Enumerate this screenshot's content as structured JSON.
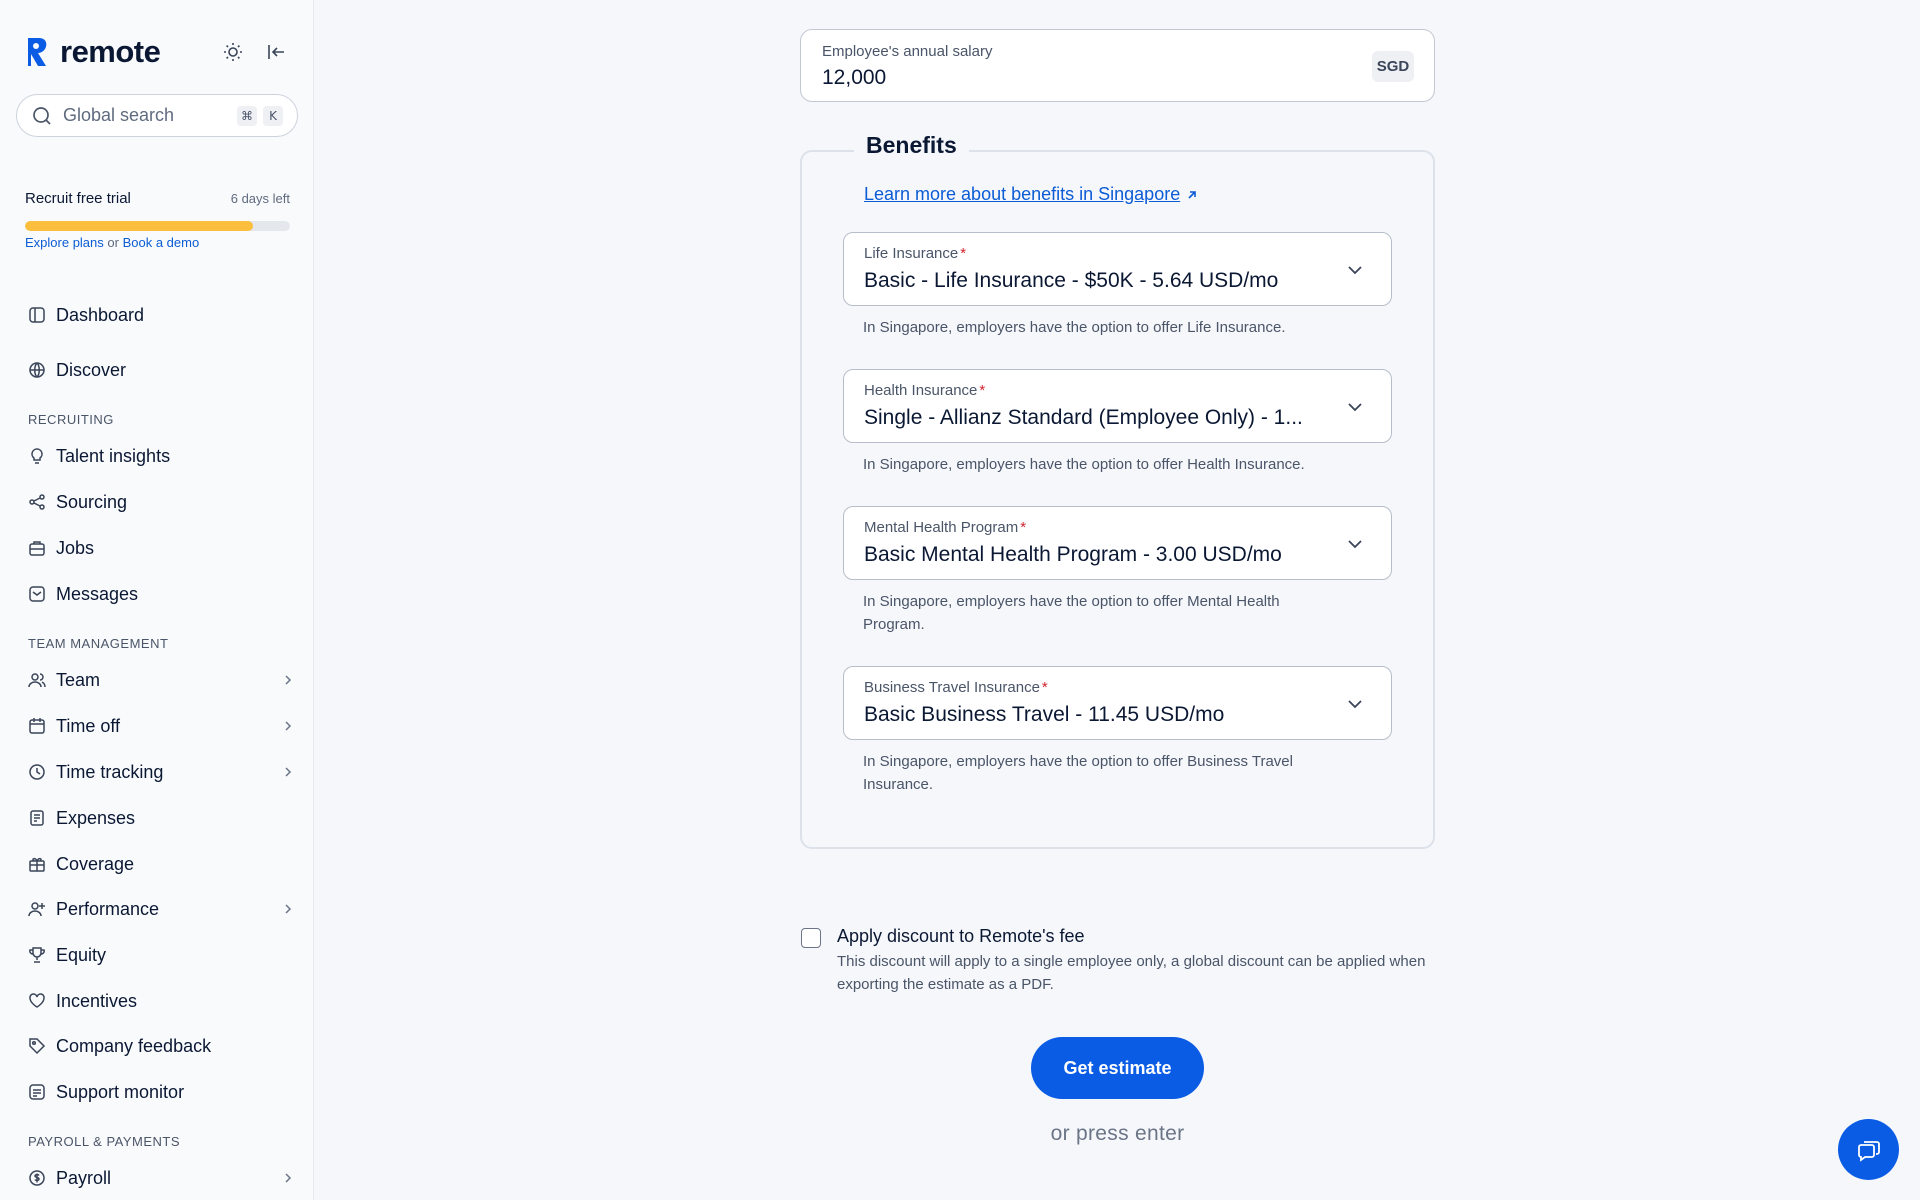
{
  "brand": {
    "name": "remote"
  },
  "search": {
    "placeholder": "Global search",
    "shortcut_cmd": "⌘",
    "shortcut_key": "K"
  },
  "trial": {
    "title": "Recruit free trial",
    "days_left": "6 days left",
    "progress_fraction": 0.86,
    "explore": "Explore plans",
    "or": "or",
    "book": "Book a demo"
  },
  "nav": {
    "dashboard": "Dashboard",
    "discover": "Discover",
    "section_recruiting": "RECRUITING",
    "talent_insights": "Talent insights",
    "sourcing": "Sourcing",
    "jobs": "Jobs",
    "messages": "Messages",
    "section_team": "TEAM MANAGEMENT",
    "team": "Team",
    "time_off": "Time off",
    "time_tracking": "Time tracking",
    "expenses": "Expenses",
    "coverage": "Coverage",
    "performance": "Performance",
    "equity": "Equity",
    "incentives": "Incentives",
    "company_feedback": "Company feedback",
    "support_monitor": "Support monitor",
    "section_payroll": "PAYROLL & PAYMENTS",
    "payroll": "Payroll"
  },
  "salary": {
    "label": "Employee's annual salary",
    "value": "12,000",
    "currency": "SGD"
  },
  "benefits": {
    "title": "Benefits",
    "learn_more": "Learn more about benefits in Singapore",
    "life": {
      "label": "Life Insurance",
      "value": "Basic - Life Insurance - $50K - 5.64 USD/mo",
      "hint": "In Singapore, employers have the option to offer Life Insurance."
    },
    "health": {
      "label": "Health Insurance",
      "value": "Single - Allianz Standard (Employee Only) - 1...",
      "hint": "In Singapore, employers have the option to offer Health Insurance."
    },
    "mental": {
      "label": "Mental Health Program",
      "value": "Basic Mental Health Program - 3.00 USD/mo",
      "hint": "In Singapore, employers have the option to offer Mental Health Program."
    },
    "travel": {
      "label": "Business Travel Insurance",
      "value": "Basic Business Travel - 11.45 USD/mo",
      "hint": "In Singapore, employers have the option to offer Business Travel Insurance."
    },
    "required_mark": "*"
  },
  "discount": {
    "title": "Apply discount to Remote's fee",
    "description": "This discount will apply to a single employee only, a global discount can be applied when exporting the estimate as a PDF."
  },
  "actions": {
    "get_estimate": "Get estimate",
    "or_press_enter": "or press enter"
  },
  "colors": {
    "accent": "#0a5ce4",
    "link": "#0b5cd5",
    "trial_bar": "#fbbf3d",
    "required": "#d1242f"
  }
}
